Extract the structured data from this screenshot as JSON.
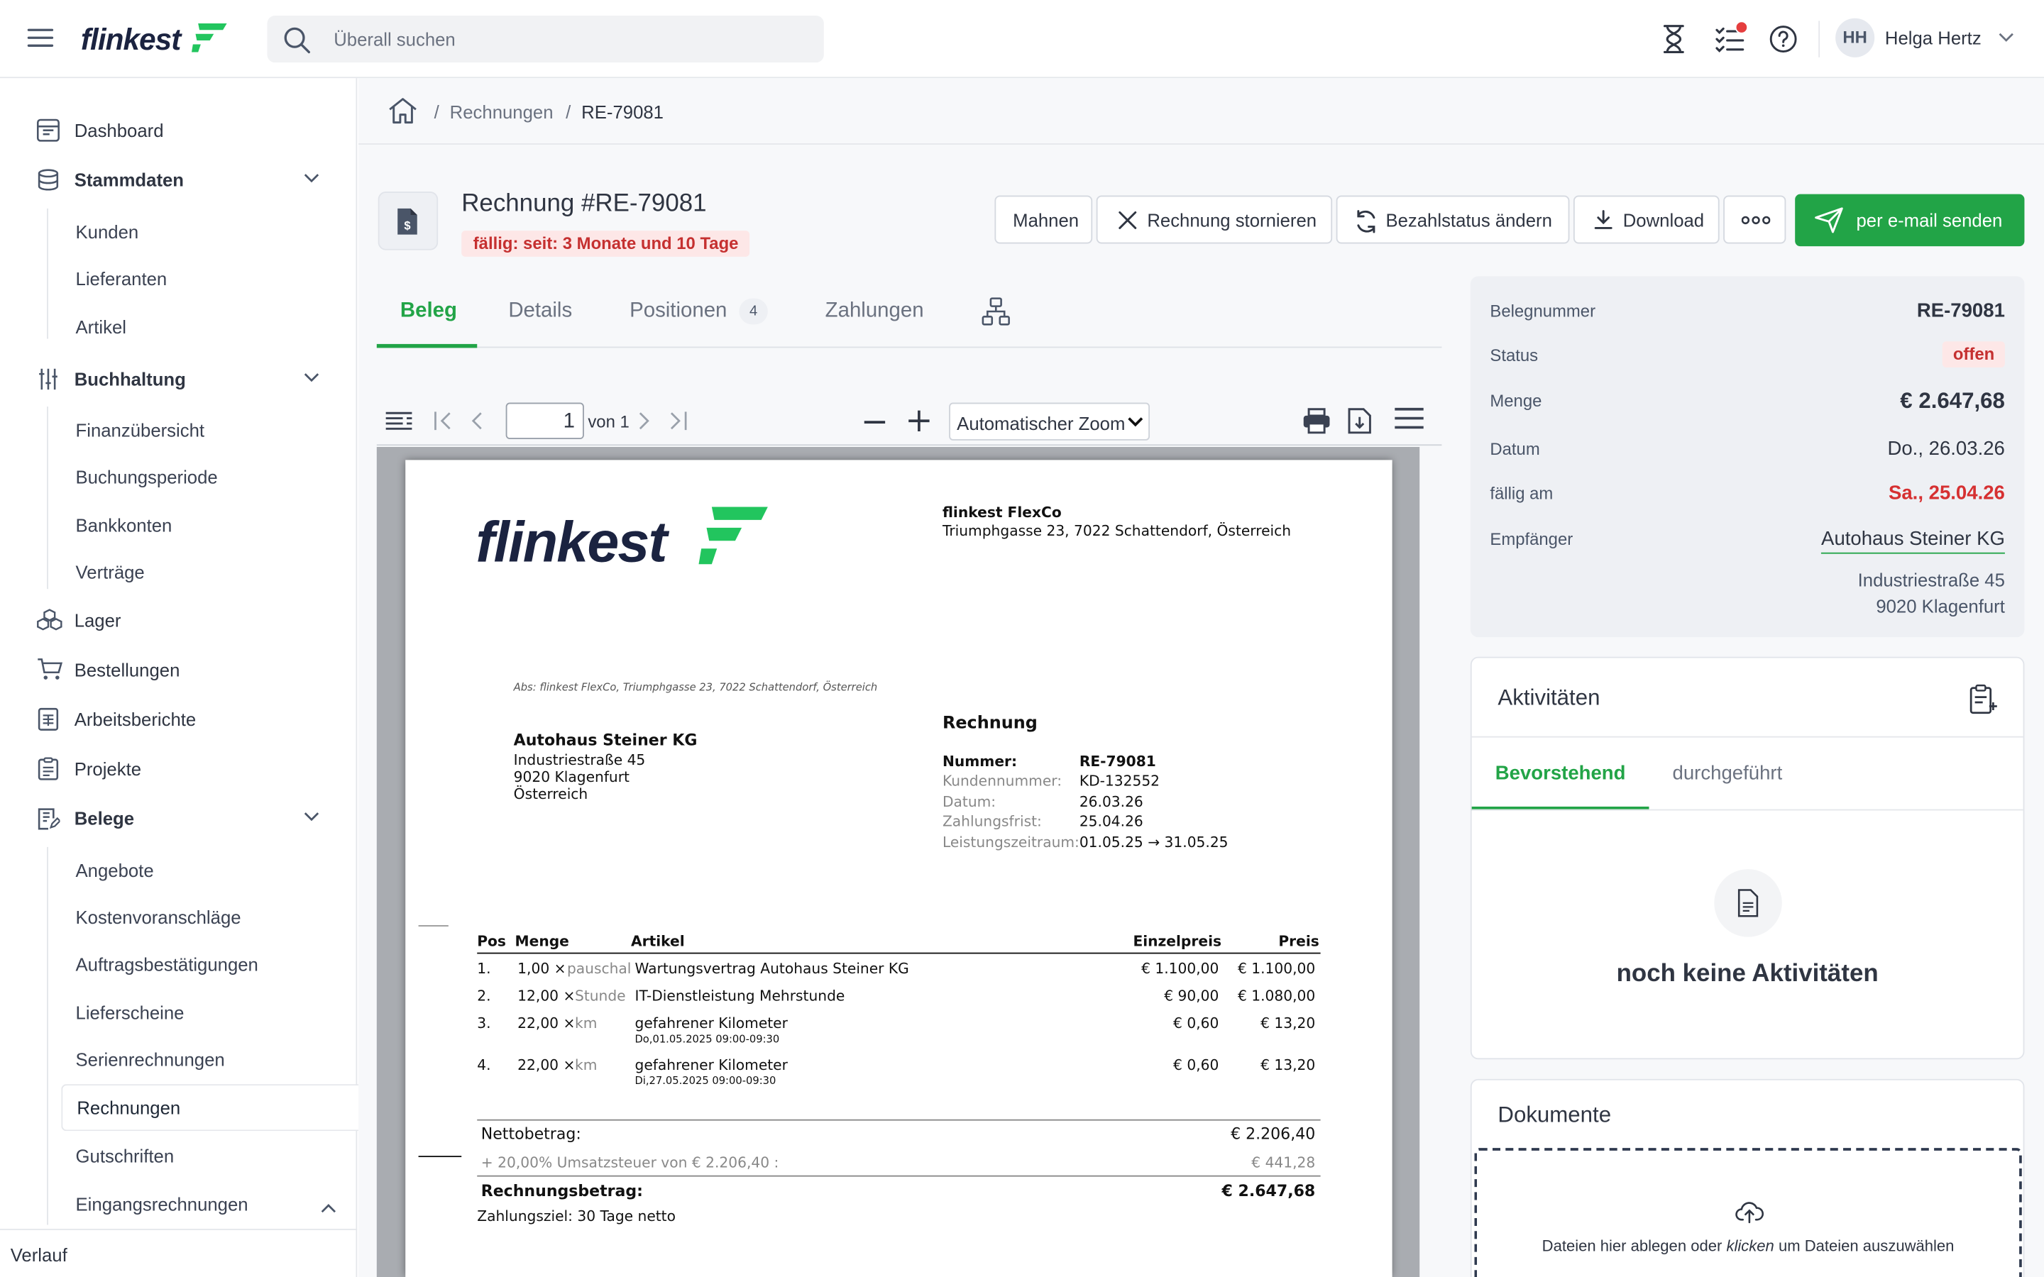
{
  "header": {
    "search_placeholder": "Überall suchen",
    "user_initials": "HH",
    "user_name": "Helga Hertz",
    "accent_color": "#22a447",
    "notification_color": "#e53e3e"
  },
  "sidebar": {
    "dashboard": "Dashboard",
    "stammdaten": "Stammdaten",
    "kunden": "Kunden",
    "lieferanten": "Lieferanten",
    "artikel": "Artikel",
    "buchhaltung": "Buchhaltung",
    "finanzuebersicht": "Finanzübersicht",
    "buchungsperiode": "Buchungsperiode",
    "bankkonten": "Bankkonten",
    "vertraege": "Verträge",
    "lager": "Lager",
    "bestellungen": "Bestellungen",
    "arbeitsberichte": "Arbeitsberichte",
    "projekte": "Projekte",
    "belege": "Belege",
    "angebote": "Angebote",
    "kostenvoranschlaege": "Kostenvoranschläge",
    "auftragsbestaetigungen": "Auftragsbestätigungen",
    "lieferscheine": "Lieferscheine",
    "serienrechnungen": "Serienrechnungen",
    "rechnungen": "Rechnungen",
    "gutschriften": "Gutschriften",
    "eingangsrechnungen": "Eingangsrechnungen",
    "verlauf": "Verlauf"
  },
  "breadcrumb": {
    "sep1": "/",
    "level1": "Rechnungen",
    "sep2": "/",
    "level2": "RE-79081"
  },
  "invoice": {
    "title": "Rechnung #RE-79081",
    "due_badge": "fällig: seit: 3 Monate und 10 Tage"
  },
  "actions": {
    "mahnen": "Mahnen",
    "stornieren": "Rechnung stornieren",
    "bezahlstatus": "Bezahlstatus ändern",
    "download": "Download",
    "email": "per e-mail senden"
  },
  "tabs": {
    "beleg": "Beleg",
    "details": "Details",
    "positionen": "Positionen",
    "positionen_count": "4",
    "zahlungen": "Zahlungen"
  },
  "pdf": {
    "page_current": "1",
    "page_of": "von 1",
    "zoom": "Automatischer Zoom",
    "company_name": "flinkest FlexCo",
    "company_address": "Triumphgasse 23, 7022 Schattendorf, Österreich",
    "sender_line": "Abs: flinkest FlexCo, Triumphgasse 23, 7022 Schattendorf, Österreich",
    "recipient": [
      "Autohaus Steiner KG",
      "Industriestraße 45",
      "9020 Klagenfurt",
      "Österreich"
    ],
    "doc_type": "Rechnung",
    "meta": [
      {
        "k": "Nummer:",
        "v": "RE-79081"
      },
      {
        "k": "Kundennummer:",
        "v": "KD-132552"
      },
      {
        "k": "Datum:",
        "v": "26.03.26"
      },
      {
        "k": "Zahlungsfrist:",
        "v": "25.04.26"
      },
      {
        "k": "Leistungszeitraum:",
        "v": "01.05.25 → 31.05.25"
      }
    ],
    "columns": {
      "pos": "Pos",
      "menge": "Menge",
      "artikel": "Artikel",
      "einzelpreis": "Einzelpreis",
      "preis": "Preis"
    },
    "rows": [
      {
        "pos": "1.",
        "qty": "1,00 ×",
        "unit": "pauschal",
        "article": "Wartungsvertrag Autohaus Steiner KG",
        "sub": "",
        "unit_price": "€ 1.100,00",
        "price": "€ 1.100,00"
      },
      {
        "pos": "2.",
        "qty": "12,00 ×",
        "unit": "Stunde",
        "article": "IT-Dienstleistung Mehrstunde",
        "sub": "",
        "unit_price": "€ 90,00",
        "price": "€ 1.080,00"
      },
      {
        "pos": "3.",
        "qty": "22,00 ×",
        "unit": "km",
        "article": "gefahrener Kilometer",
        "sub": "Do,01.05.2025 09:00-09:30",
        "unit_price": "€ 0,60",
        "price": "€ 13,20"
      },
      {
        "pos": "4.",
        "qty": "22,00 ×",
        "unit": "km",
        "article": "gefahrener Kilometer",
        "sub": "Di,27.05.2025 09:00-09:30",
        "unit_price": "€ 0,60",
        "price": "€ 13,20"
      }
    ],
    "netto_label": "Nettobetrag:",
    "netto_value": "€ 2.206,40",
    "ust_label": "+ 20,00% Umsatzsteuer von € 2.206,40 :",
    "ust_value": "€ 441,28",
    "total_label": "Rechnungsbetrag:",
    "total_value": "€ 2.647,68",
    "payment_terms": "Zahlungsziel: 30 Tage netto"
  },
  "info": {
    "belegnummer_label": "Belegnummer",
    "belegnummer": "RE-79081",
    "status_label": "Status",
    "status": "offen",
    "menge_label": "Menge",
    "menge": "€ 2.647,68",
    "datum_label": "Datum",
    "datum": "Do., 26.03.26",
    "faellig_label": "fällig am",
    "faellig": "Sa., 25.04.26",
    "empfaenger_label": "Empfänger",
    "empfaenger": "Autohaus Steiner KG",
    "addr1": "Industriestraße 45",
    "addr2": "9020 Klagenfurt"
  },
  "activities": {
    "title": "Aktivitäten",
    "tab_upcoming": "Bevorstehend",
    "tab_done": "durchgeführt",
    "empty": "noch keine Aktivitäten"
  },
  "documents": {
    "title": "Dokumente",
    "drop_before": "Dateien hier ablegen oder ",
    "drop_em": "klicken",
    "drop_after": " um Dateien auszuwählen"
  }
}
